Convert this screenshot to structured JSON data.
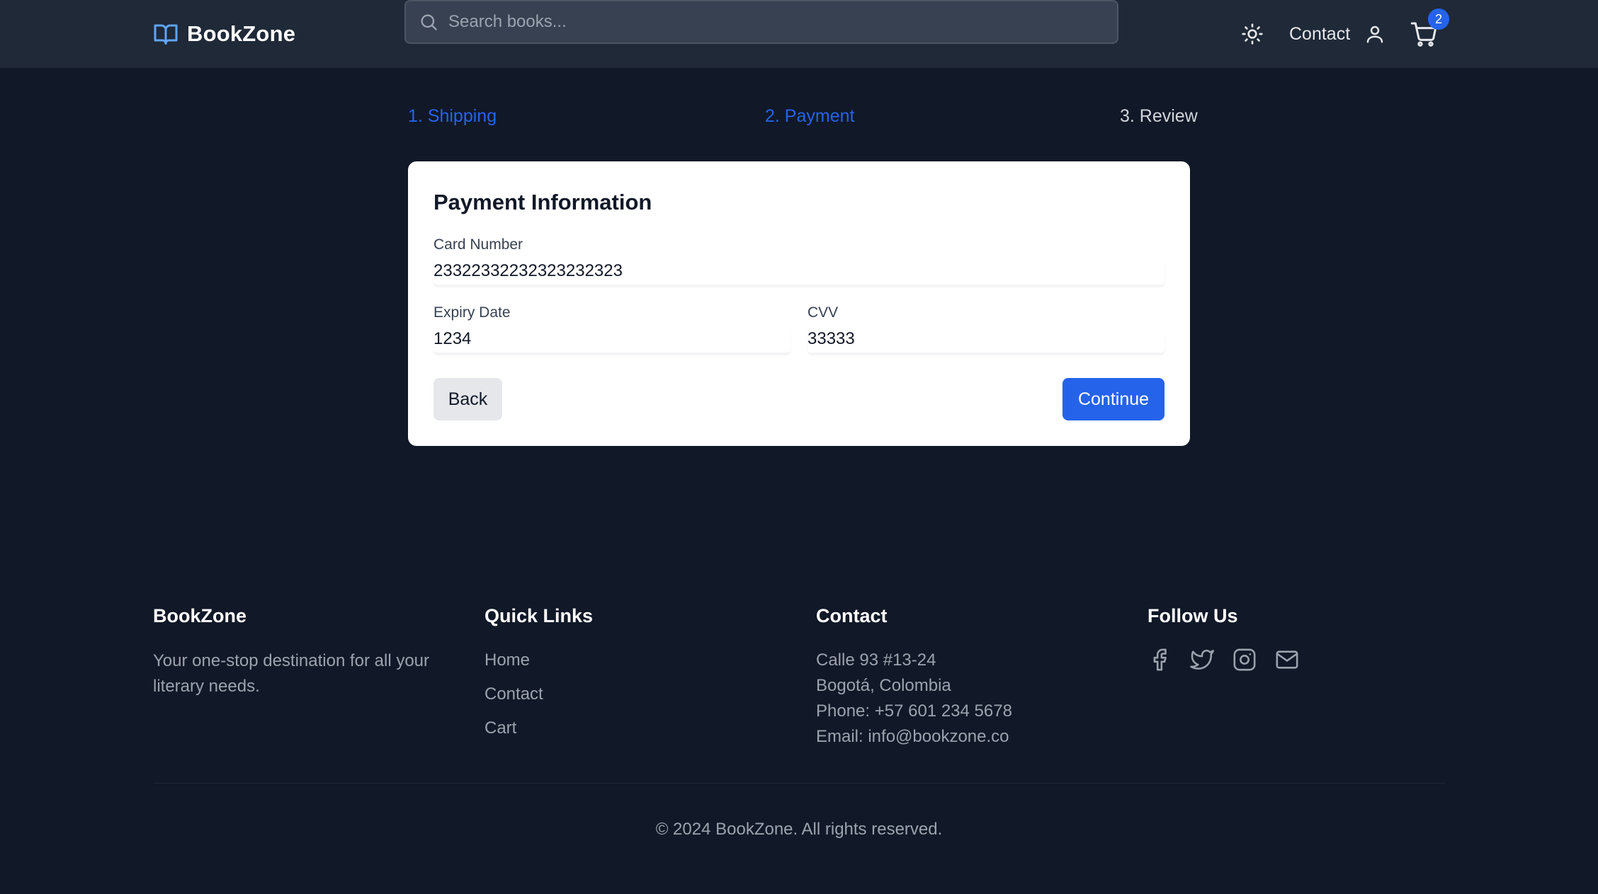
{
  "header": {
    "brand": "BookZone",
    "search_placeholder": "Search books...",
    "contact_label": "Contact",
    "cart_count": "2"
  },
  "steps": [
    {
      "label": "1. Shipping",
      "state": "active"
    },
    {
      "label": "2. Payment",
      "state": "active"
    },
    {
      "label": "3. Review",
      "state": "inactive"
    }
  ],
  "payment": {
    "title": "Payment Information",
    "card_number_label": "Card Number",
    "card_number_value": "23322332232323232323",
    "expiry_label": "Expiry Date",
    "expiry_value": "1234",
    "cvv_label": "CVV",
    "cvv_value": "33333",
    "back_label": "Back",
    "continue_label": "Continue"
  },
  "footer": {
    "brand_title": "BookZone",
    "brand_tagline_line1": "Your one-stop destination for all your",
    "brand_tagline_line2": "literary needs.",
    "quick_links_title": "Quick Links",
    "quick_links": [
      "Home",
      "Contact",
      "Cart"
    ],
    "contact_title": "Contact",
    "contact_lines": [
      "Calle 93 #13-24",
      "Bogotá, Colombia",
      "Phone: +57 601 234 5678",
      "Email: info@bookzone.co"
    ],
    "follow_title": "Follow Us",
    "social_icons": [
      "facebook-icon",
      "twitter-icon",
      "instagram-icon",
      "mail-icon"
    ],
    "copyright": "© 2024 BookZone. All rights reserved."
  },
  "colors": {
    "background": "#111827",
    "header": "#1f2937",
    "accent": "#2563eb",
    "logo_icon": "#60a5fa"
  }
}
